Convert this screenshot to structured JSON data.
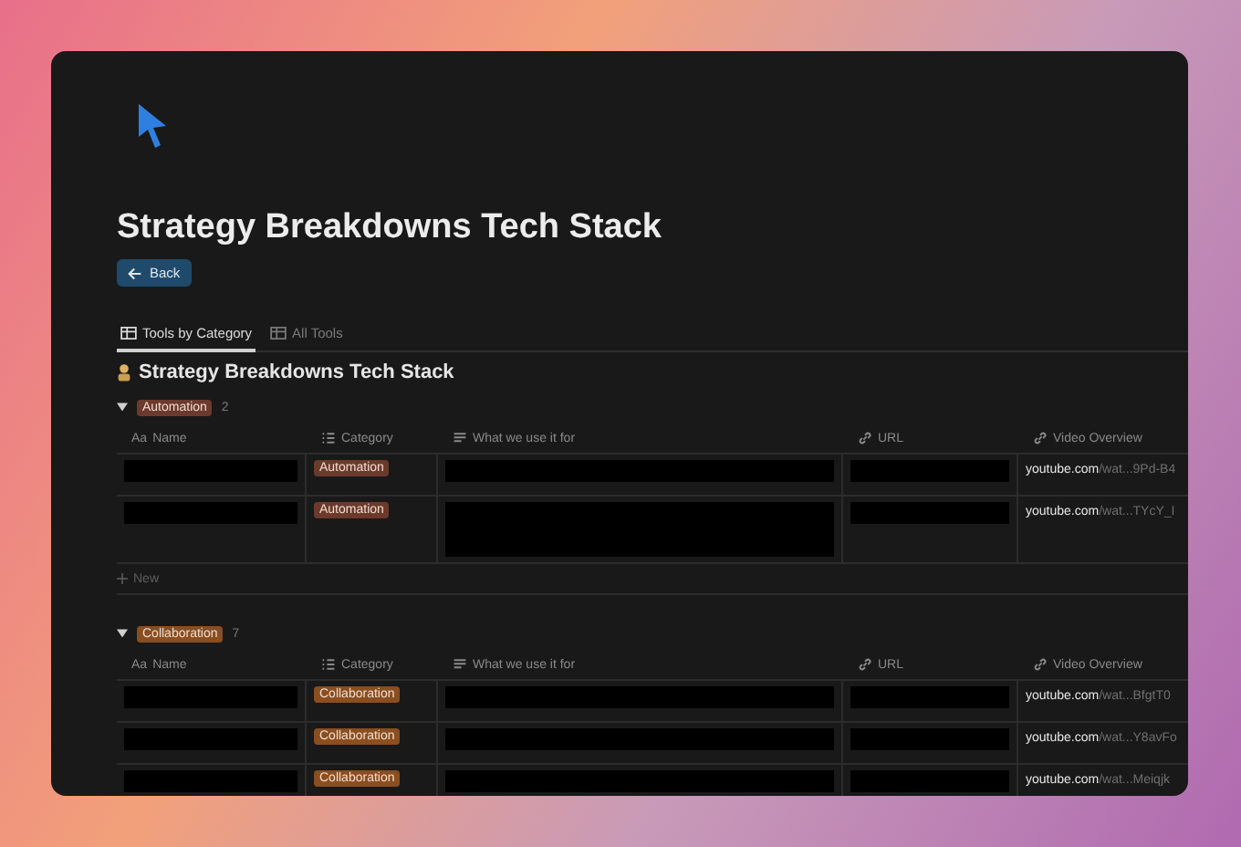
{
  "page": {
    "title": "Strategy Breakdowns Tech Stack",
    "back_button": "Back"
  },
  "tabs": [
    {
      "label": "Tools by Category",
      "selected": true
    },
    {
      "label": "All Tools",
      "selected": false
    }
  ],
  "database_title": "Strategy Breakdowns Tech Stack",
  "groups": [
    {
      "label": "Automation",
      "count": "2",
      "color": "#6b3a2c",
      "expanded": true,
      "new_label": "New",
      "columns": [
        {
          "label": "Name",
          "kind": "title",
          "icon_text": "Aa"
        },
        {
          "label": "Category",
          "kind": "list"
        },
        {
          "label": "What we use it for",
          "kind": "text"
        },
        {
          "label": "URL",
          "kind": "link"
        },
        {
          "label": "Video Overview",
          "kind": "link"
        }
      ],
      "rows": [
        {
          "category": "Automation",
          "video_domain": "youtube.com",
          "video_path": "/wat...9Pd-B4",
          "tall": false
        },
        {
          "category": "Automation",
          "video_domain": "youtube.com",
          "video_path": "/wat...TYcY_I",
          "tall": true
        }
      ]
    },
    {
      "label": "Collaboration",
      "count": "7",
      "color": "#8a4e1f",
      "expanded": true,
      "columns": [
        {
          "label": "Name",
          "kind": "title",
          "icon_text": "Aa"
        },
        {
          "label": "Category",
          "kind": "list"
        },
        {
          "label": "What we use it for",
          "kind": "text"
        },
        {
          "label": "URL",
          "kind": "link"
        },
        {
          "label": "Video Overview",
          "kind": "link"
        }
      ],
      "rows": [
        {
          "category": "Collaboration",
          "video_domain": "youtube.com",
          "video_path": "/wat...BfgtT0",
          "tall": false
        },
        {
          "category": "Collaboration",
          "video_domain": "youtube.com",
          "video_path": "/wat...Y8avFo",
          "tall": false
        },
        {
          "category": "Collaboration",
          "video_domain": "youtube.com",
          "video_path": "/wat...Meiqjk",
          "tall": false
        }
      ]
    }
  ]
}
